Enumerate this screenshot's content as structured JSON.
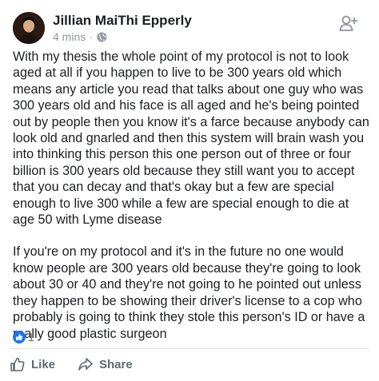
{
  "post": {
    "author": "Jillian MaiThi Epperly",
    "time": "4 mins",
    "separator": "·",
    "privacy_icon": "globe-icon",
    "paragraphs": [
      "With my thesis the whole point of my protocol is not to look aged at all if you happen to live to be 300 years old which means any article you read that talks about one guy who was 300 years old and his face is all aged and he's being pointed out by people then you know it's a farce because anybody can look old and gnarled and then this system will brain wash you into thinking this person this one person out of three or four billion is 300 years old because they still want you to accept that you can decay and that's okay but a few are special enough to live 300 while a few are special enough to die at age 50 with Lyme disease",
      "If you're on my protocol and it's in the future no one would know people are 300 years old because they're going to look about 30 or 40 and they're not going to he pointed out unless they happen to be showing their driver's license to a cop who probably is going to think they stole this person's ID or have a really good plastic surgeon"
    ],
    "reaction_count": "1"
  },
  "actions": {
    "like_label": "Like",
    "share_label": "Share"
  },
  "colors": {
    "accent": "#1877f2",
    "text": "#1c1e21",
    "muted": "#90949c",
    "action": "#606770"
  }
}
